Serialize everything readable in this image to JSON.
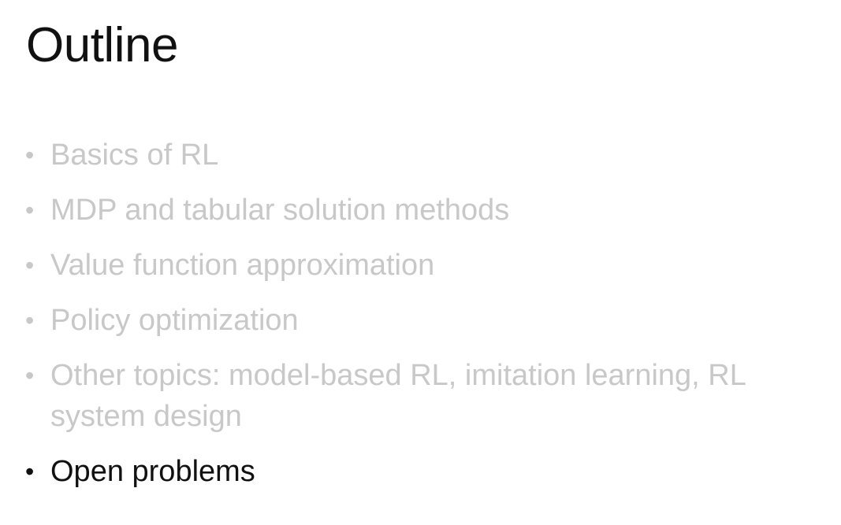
{
  "slide": {
    "title": "Outline",
    "bullets": [
      {
        "text": "Basics of RL",
        "active": false
      },
      {
        "text": "MDP and tabular solution methods",
        "active": false
      },
      {
        "text": "Value function approximation",
        "active": false
      },
      {
        "text": "Policy optimization",
        "active": false
      },
      {
        "text": "Other topics: model-based RL, imitation learning, RL system design",
        "active": false
      },
      {
        "text": "Open problems",
        "active": true
      }
    ],
    "bullet_glyph": "•",
    "colors": {
      "inactive": "#c8c8c8",
      "active": "#111111",
      "background": "#ffffff"
    }
  }
}
